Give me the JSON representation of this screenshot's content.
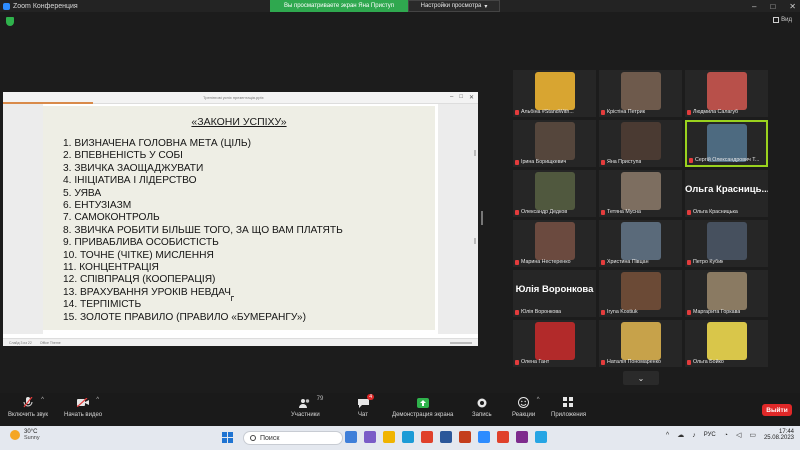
{
  "window": {
    "title": "Zoom Конференция",
    "share_banner": "Вы просматриваете экран Яна Приступ",
    "view_options": "Настройки просмотра",
    "view_button": "Вид"
  },
  "presentation": {
    "doc_title": "Тренінгові успіх презентація.pptx",
    "slide_title": "«ЗАКОНИ УСПІХУ»",
    "rules": [
      "1. ВИЗНАЧЕНА ГОЛОВНА МЕТА (ЦІЛЬ)",
      "2. ВПЕВНЕНІСТЬ У СОБІ",
      "3. ЗВИЧКА ЗАОЩАДЖУВАТИ",
      "4. ІНІЦІАТИВА І ЛІДЕРСТВО",
      "5. УЯВА",
      "6. ЕНТУЗІАЗМ",
      "7. САМОКОНТРОЛЬ",
      "8. ЗВИЧКА РОБИТИ БІЛЬШЕ ТОГО, ЗА ЩО ВАМ ПЛАТЯТЬ",
      "9. ПРИВАБЛИВА ОСОБИСТІСТЬ",
      "10. ТОЧНЕ (ЧІТКЕ) МИСЛЕННЯ",
      "11. КОНЦЕНТРАЦІЯ",
      "12. СПІВПРАЦЯ (КООПЕРАЦІЯ)",
      "13. ВРАХУВАННЯ УРОКІВ НЕВДАЧ",
      "14. ТЕРПІМІСТЬ",
      "15. ЗОЛОТЕ ПРАВИЛО (ПРАВИЛО «БУМЕРАНГУ»)"
    ],
    "status_left": "Слайд 3 из 22",
    "status_lang": "Office Theme"
  },
  "participants": [
    {
      "name": "Альбіна #StandWith...",
      "color": "#d8a531",
      "big": ""
    },
    {
      "name": "Крістіна Петрик",
      "color": "#6e5a4c",
      "big": ""
    },
    {
      "name": "Людмила Салагуб",
      "color": "#b8504a",
      "big": ""
    },
    {
      "name": "Ірина Борищкевич",
      "color": "#55463c",
      "big": ""
    },
    {
      "name": "Яна Приступа",
      "color": "#4a3a32",
      "big": ""
    },
    {
      "name": "Сергій Олександрович Т...",
      "color": "#4d6a80",
      "big": ""
    },
    {
      "name": "Олександр Дедков",
      "color": "#50583e",
      "big": ""
    },
    {
      "name": "Тетяна Мусна",
      "color": "#7d6e60",
      "big": ""
    },
    {
      "name": "Ольга Красницька",
      "color": "",
      "big": "Ольга Красниць..."
    },
    {
      "name": "Марина Нестеренко",
      "color": "#6b4a3f",
      "big": ""
    },
    {
      "name": "Христина Півцан",
      "color": "#5a6a7a",
      "big": ""
    },
    {
      "name": "Петро Кубик",
      "color": "#46505e",
      "big": ""
    },
    {
      "name": "Юлія Воронкова",
      "color": "",
      "big": "Юлія Воронкова"
    },
    {
      "name": "Iryna Kostiuk",
      "color": "#6b4a36",
      "big": ""
    },
    {
      "name": "Маргарита Горкава",
      "color": "#8a7a62",
      "big": ""
    },
    {
      "name": "Олена Гант",
      "color": "#b22a2a",
      "big": ""
    },
    {
      "name": "Наталія Пономаренко",
      "color": "#c7a24a",
      "big": ""
    },
    {
      "name": "Ольга Бойко",
      "color": "#d9c64a",
      "big": ""
    }
  ],
  "toolbar": {
    "audio": "Включить звук",
    "video": "Начать видео",
    "participants": "Участники",
    "participants_count": "79",
    "chat": "Чат",
    "chat_badge": "4",
    "share": "Демонстрация экрана",
    "record": "Запись",
    "reactions": "Реакции",
    "apps": "Приложения",
    "leave": "Выйти"
  },
  "taskbar": {
    "temp": "30°C",
    "weather": "Sunny",
    "search_placeholder": "Поиск",
    "lang": "РУС",
    "time": "17:44",
    "date": "25.08.2023"
  },
  "colors": {
    "share_green": "#2fa84f",
    "active_border": "#9ad21e",
    "leave_red": "#e02828"
  }
}
